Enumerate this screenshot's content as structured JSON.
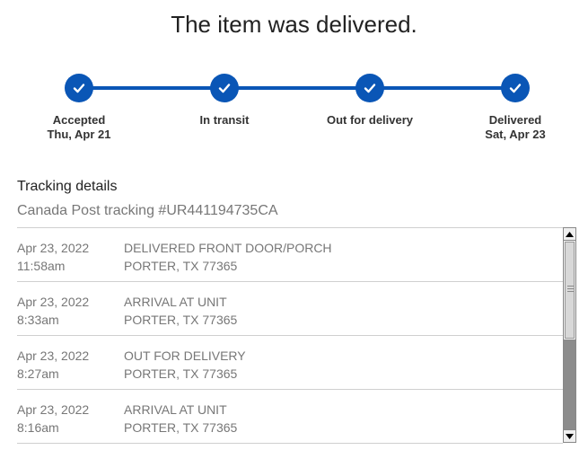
{
  "header": {
    "title": "The item was delivered."
  },
  "progress": {
    "accent_color": "#0a56b6",
    "steps": [
      {
        "label": "Accepted",
        "date": "Thu, Apr 21",
        "completed": true,
        "icon": "check-icon"
      },
      {
        "label": "In transit",
        "date": "",
        "completed": true,
        "icon": "check-icon"
      },
      {
        "label": "Out for delivery",
        "date": "",
        "completed": true,
        "icon": "check-icon"
      },
      {
        "label": "Delivered",
        "date": "Sat, Apr 23",
        "completed": true,
        "icon": "check-icon"
      }
    ]
  },
  "details": {
    "title": "Tracking details",
    "tracking_number_text": "Canada Post tracking #UR441194735CA",
    "events": [
      {
        "date": "Apr 23, 2022",
        "time": "11:58am",
        "status": "DELIVERED FRONT DOOR/PORCH",
        "location": "PORTER, TX 77365"
      },
      {
        "date": "Apr 23, 2022",
        "time": "8:33am",
        "status": "ARRIVAL AT UNIT",
        "location": "PORTER, TX 77365"
      },
      {
        "date": "Apr 23, 2022",
        "time": "8:27am",
        "status": "OUT FOR DELIVERY",
        "location": "PORTER, TX 77365"
      },
      {
        "date": "Apr 23, 2022",
        "time": "8:16am",
        "status": "ARRIVAL AT UNIT",
        "location": "PORTER, TX 77365"
      }
    ]
  }
}
